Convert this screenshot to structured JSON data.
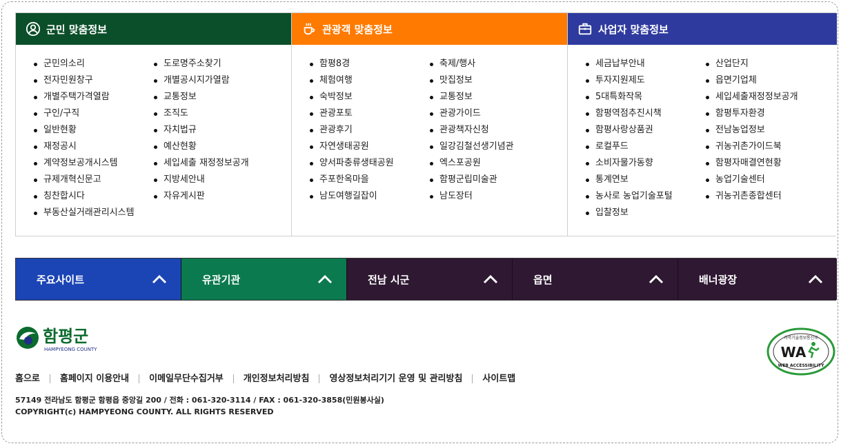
{
  "sections": [
    {
      "title": "군민 맞춤정보",
      "color": "#0b4f2a",
      "icon": "person-circle-icon",
      "col1": [
        "군민의소리",
        "전자민원창구",
        "개별주택가격열람",
        "구인/구직",
        "일반현황",
        "재정공시",
        "계약정보공개시스템",
        "규제개혁신문고",
        "칭찬합시다",
        "부동산실거래관리시스템"
      ],
      "col2": [
        "도로명주소찾기",
        "개별공시지가열람",
        "교통정보",
        "조직도",
        "자치법규",
        "예산현황",
        "세입세출 재정정보공개",
        "지방세안내",
        "자유게시판"
      ]
    },
    {
      "title": "관광객 맞춤정보",
      "color": "#ff7a00",
      "icon": "coffee-cup-icon",
      "col1": [
        "함평8경",
        "체험여행",
        "숙박정보",
        "관광포토",
        "관광후기",
        "자연생태공원",
        "양서파충류생태공원",
        "주포한옥마을",
        "남도여행길잡이"
      ],
      "col2": [
        "축제/행사",
        "맛집정보",
        "교통정보",
        "관광가이드",
        "관광책자신청",
        "일강김철선생기념관",
        "엑스포공원",
        "함평군립미술관",
        "남도장터"
      ]
    },
    {
      "title": "사업자 맞춤정보",
      "color": "#2e3a9e",
      "icon": "briefcase-icon",
      "col1": [
        "세금납부안내",
        "투자지원제도",
        "5대특화작목",
        "함평역점추진시책",
        "함평사랑상품권",
        "로컬푸드",
        "소비자물가동향",
        "통계연보",
        "농사로 농업기술포털",
        "입찰정보"
      ],
      "col2": [
        "산업단지",
        "읍면기업체",
        "세입세출재정정보공개",
        "함평투자환경",
        "전남농업정보",
        "귀농귀촌가이드북",
        "함평자매결연현황",
        "농업기술센터",
        "귀농귀촌종합센터"
      ]
    }
  ],
  "tabs": [
    {
      "label": "주요사이트",
      "color": "#1b45b5"
    },
    {
      "label": "유관기관",
      "color": "#0b7a4e"
    },
    {
      "label": "전남 시군",
      "color": "#2f1832"
    },
    {
      "label": "읍면",
      "color": "#2f1832"
    },
    {
      "label": "배너광장",
      "color": "#2f1832"
    }
  ],
  "logo": {
    "name": "함평군",
    "sub": "HAMPYEONG COUNTY"
  },
  "wa_badge": {
    "top": "과학기술정보통신부",
    "mark": "WA",
    "bottom": "WEB ACCESSIBILITY"
  },
  "footer_links": [
    "홈으로",
    "홈페이지 이용안내",
    "이메일무단수집거부",
    "개인정보처리방침",
    "영상정보처리기기 운영 및 관리방침",
    "사이트맵"
  ],
  "address": "57149 전라남도 함평군 함평읍 중앙길 200 / 전화 : 061-320-3114 / FAX : 061-320-3858(민원봉사실)",
  "copyright": "COPYRIGHT(c) HAMPYEONG COUNTY. ALL RIGHTS RESERVED"
}
